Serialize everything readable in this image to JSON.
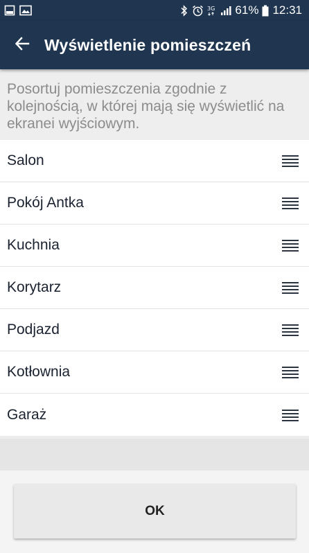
{
  "status_bar": {
    "left_icons": [
      "notification-box-icon",
      "image-notification-icon"
    ],
    "right_icons": [
      "bluetooth-icon",
      "alarm-icon",
      "network-3g-icon",
      "signal-icon"
    ],
    "network_type": "3G",
    "battery_percent": "61%",
    "time": "12:31"
  },
  "app_bar": {
    "back_icon": "arrow-left-icon",
    "title": "Wyświetlenie pomieszczeń"
  },
  "description": "Posortuj pomieszczenia zgodnie z kolejnością, w której mają się wyświetlić na ekranei wyjściowym.",
  "rooms": [
    {
      "name": "Salon"
    },
    {
      "name": "Pokój Antka"
    },
    {
      "name": "Kuchnia"
    },
    {
      "name": "Korytarz"
    },
    {
      "name": "Podjazd"
    },
    {
      "name": "Kotłownia"
    },
    {
      "name": "Garaż"
    }
  ],
  "buttons": {
    "ok_label": "OK"
  },
  "colors": {
    "primary": "#1f3550",
    "list_background": "#ffffff",
    "description_text": "#8c8c8c"
  }
}
